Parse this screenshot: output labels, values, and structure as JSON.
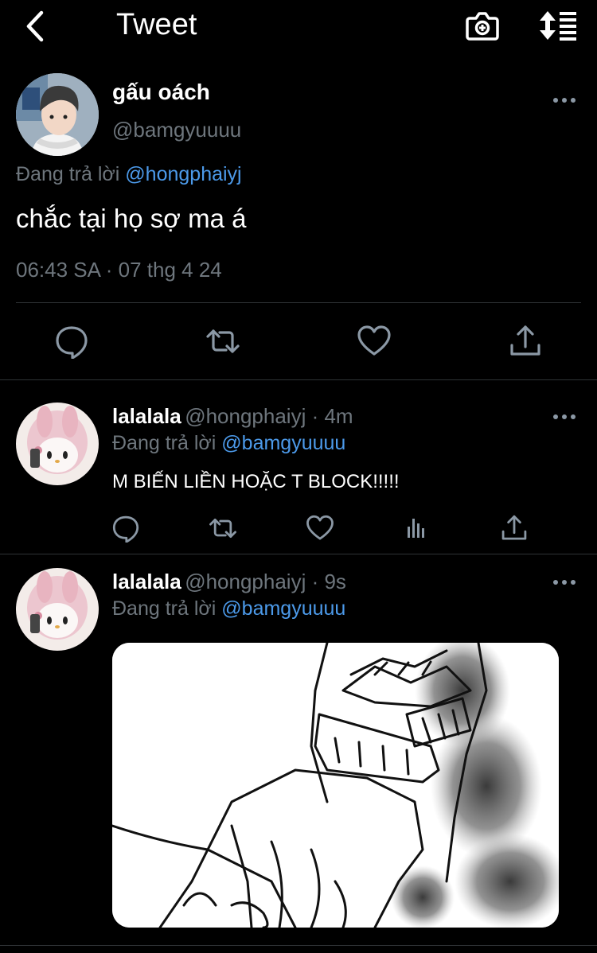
{
  "header": {
    "title": "Tweet",
    "back_icon": "chevron-left-icon",
    "camera_icon": "camera-plus-icon",
    "sort_icon": "sort-icon"
  },
  "main_tweet": {
    "author_name": "gấu oách",
    "author_handle": "@bamgyuuuu",
    "reply_prefix": "Đang trả lời",
    "reply_to": "@hongphaiyj",
    "text": "chắc tại họ sợ ma á",
    "timestamp": "06:43 SA · 07 thg 4 24",
    "actions": [
      "reply-icon",
      "retweet-icon",
      "like-icon",
      "share-icon"
    ]
  },
  "replies": [
    {
      "author_name": "lalalala",
      "author_handle": "@hongphaiyj · 4m",
      "reply_prefix": "Đang trả lời",
      "reply_to": "@bamgyuuuu",
      "text": "M BIẾN LIỀN HOẶC T BLOCK!!!!!",
      "actions": [
        "reply-icon",
        "retweet-icon",
        "like-icon",
        "analytics-icon",
        "share-icon"
      ]
    },
    {
      "author_name": "lalalala",
      "author_handle": "@hongphaiyj · 9s",
      "reply_prefix": "Đang trả lời",
      "reply_to": "@bamgyuuuu",
      "media": "manga-sketch-image"
    }
  ],
  "colors": {
    "background": "#000000",
    "link": "#4c9aea",
    "muted": "#6e767d",
    "divider": "#2f3336"
  }
}
